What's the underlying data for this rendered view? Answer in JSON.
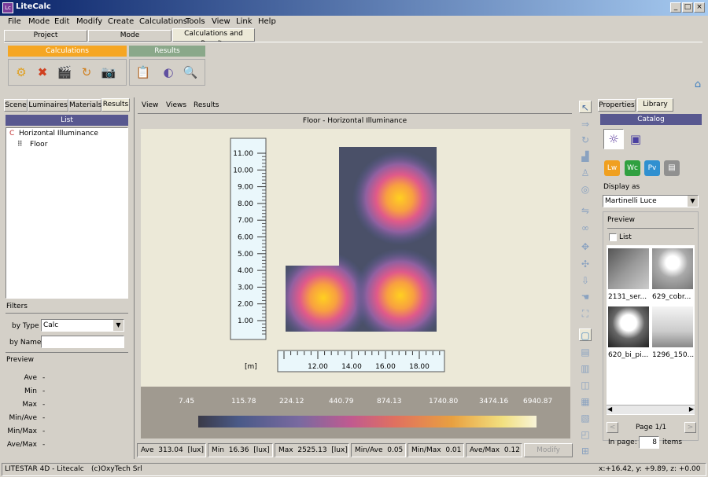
{
  "window": {
    "title": "LiteCalc",
    "app_icon": "Lc",
    "minimize": "_",
    "maximize": "□",
    "close": "×"
  },
  "menu": [
    "File",
    "Mode",
    "Edit",
    "Modify",
    "Create",
    "Calculations",
    "Tools",
    "View",
    "Link",
    "Help"
  ],
  "top_tabs": [
    "Project",
    "Mode",
    "Calculations and Results"
  ],
  "toolbar": {
    "calc_group": "Calculations",
    "results_group": "Results",
    "calc_color": "#f5a623",
    "results_color": "#8aa88a"
  },
  "left_tabs": [
    "Scene",
    "Luminaires",
    "Materials",
    "Results"
  ],
  "list": {
    "header": "List",
    "items": [
      {
        "label": "Horizontal Illuminance",
        "icon": "C"
      },
      {
        "label": "Floor",
        "icon": "⠿"
      }
    ]
  },
  "filters": {
    "title": "Filters",
    "by_type_label": "by Type",
    "by_type_value": "Calc",
    "by_name_label": "by Name",
    "by_name_value": ""
  },
  "preview_left": {
    "title": "Preview",
    "rows": [
      {
        "label": "Ave",
        "value": "-"
      },
      {
        "label": "Min",
        "value": "-"
      },
      {
        "label": "Max",
        "value": "-"
      },
      {
        "label": "Min/Ave",
        "value": "-"
      },
      {
        "label": "Min/Max",
        "value": "-"
      },
      {
        "label": "Ave/Max",
        "value": "-"
      }
    ]
  },
  "center_tabs": [
    "View",
    "Views",
    "Results"
  ],
  "plot": {
    "title": "Floor - Horizontal Illuminance",
    "unit": "[m]",
    "y_ticks": [
      "11.00",
      "10.00",
      "9.00",
      "8.00",
      "7.00",
      "6.00",
      "5.00",
      "4.00",
      "3.00",
      "2.00",
      "1.00"
    ],
    "x_ticks": [
      "12.00",
      "14.00",
      "16.00",
      "18.00"
    ]
  },
  "legend_values": [
    "7.45",
    "115.78",
    "224.12",
    "440.79",
    "874.13",
    "1740.80",
    "3474.16",
    "6940.87"
  ],
  "stats": {
    "ave_label": "Ave",
    "ave": "313.04",
    "ave_unit": "[lux]",
    "min_label": "Min",
    "min": "16.36",
    "min_unit": "[lux]",
    "max_label": "Max",
    "max": "2525.13",
    "max_unit": "[lux]",
    "minave_label": "Min/Ave",
    "minave": "0.05",
    "minmax_label": "Min/Max",
    "minmax": "0.01",
    "avemax_label": "Ave/Max",
    "avemax": "0.12",
    "modify_button": "Modify"
  },
  "right_tabs": [
    "Properties",
    "Library"
  ],
  "catalog": {
    "header": "Catalog",
    "display_as_label": "Display as",
    "display_as_value": "Martinelli Luce",
    "preview_title": "Preview",
    "list_checkbox": "List",
    "items": [
      "2131_ser...",
      "629_cobr...",
      "620_bi_pi...",
      "1296_150..."
    ],
    "page_label": "Page 1/1",
    "in_page_label": "In page:",
    "in_page_value": "8",
    "items_label": "items"
  },
  "status": {
    "left": "LITESTAR 4D - Litecalc",
    "company": "(c)OxyTech Srl",
    "coords": "x:+16.42, y: +9.89, z: +0.00"
  }
}
